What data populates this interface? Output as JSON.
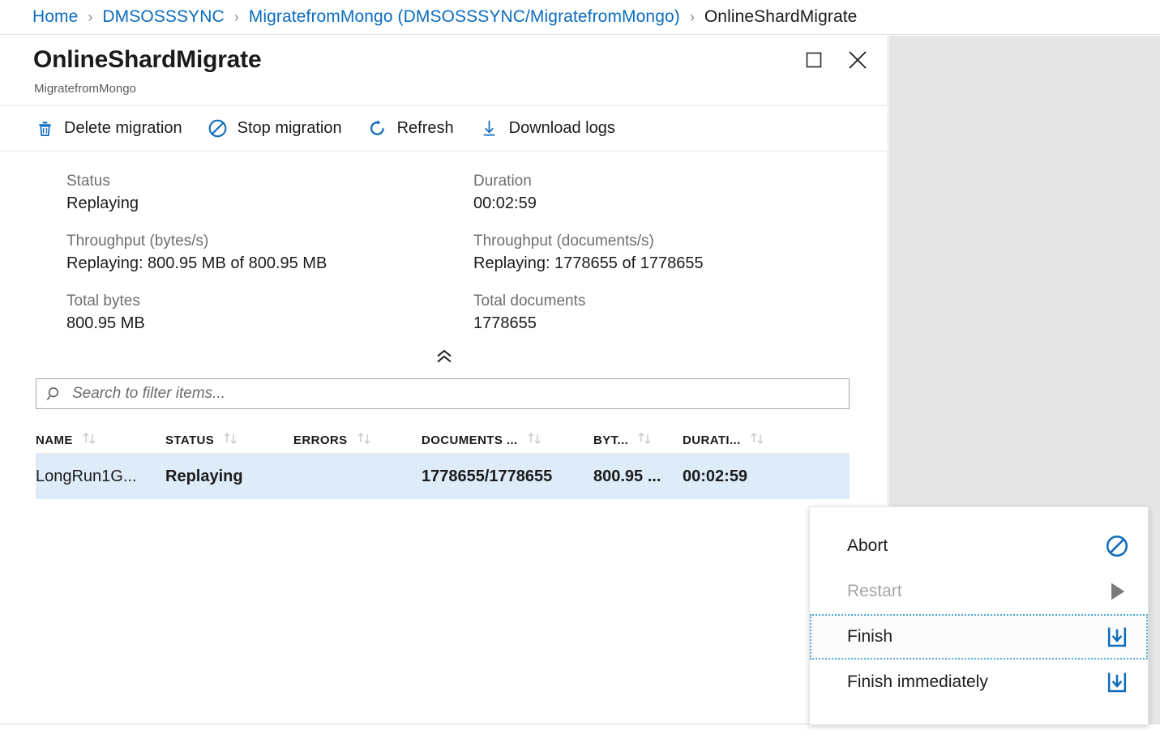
{
  "breadcrumb": {
    "separator": "›",
    "items": [
      {
        "label": "Home",
        "current": false
      },
      {
        "label": "DMSOSSSYNC",
        "current": false
      },
      {
        "label": "MigratefromMongo (DMSOSSSYNC/MigratefromMongo)",
        "current": false
      },
      {
        "label": "OnlineShardMigrate",
        "current": true
      }
    ]
  },
  "blade": {
    "title": "OnlineShardMigrate",
    "subtitle": "MigratefromMongo",
    "window_controls": [
      {
        "name": "maximize",
        "icon": "maximize-icon"
      },
      {
        "name": "close",
        "icon": "close-icon"
      }
    ]
  },
  "toolbar": {
    "commands": [
      {
        "label": "Delete migration",
        "icon": "trash-icon"
      },
      {
        "label": "Stop migration",
        "icon": "prohibition-icon"
      },
      {
        "label": "Refresh",
        "icon": "refresh-icon"
      },
      {
        "label": "Download logs",
        "icon": "download-icon"
      }
    ]
  },
  "metrics": [
    [
      {
        "label": "Status",
        "value": "Replaying"
      },
      {
        "label": "Duration",
        "value": "00:02:59"
      }
    ],
    [
      {
        "label": "Throughput (bytes/s)",
        "value": "Replaying: 800.95 MB of 800.95 MB"
      },
      {
        "label": "Throughput (documents/s)",
        "value": "Replaying: 1778655 of 1778655"
      }
    ],
    [
      {
        "label": "Total bytes",
        "value": "800.95 MB"
      },
      {
        "label": "Total documents",
        "value": "1778655"
      }
    ]
  ],
  "collapse": {
    "icon": "chevron-double-up-icon"
  },
  "search": {
    "placeholder": "Search to filter items...",
    "value": "",
    "icon": "search-icon"
  },
  "table": {
    "columns": [
      {
        "label": "NAME",
        "key": "name",
        "sortable": true
      },
      {
        "label": "STATUS",
        "key": "status",
        "sortable": true
      },
      {
        "label": "ERRORS",
        "key": "errors",
        "sortable": true
      },
      {
        "label": "DOCUMENTS ...",
        "key": "documents",
        "sortable": true
      },
      {
        "label": "BYT...",
        "key": "bytes",
        "sortable": true
      },
      {
        "label": "DURATI...",
        "key": "duration",
        "sortable": true
      }
    ],
    "rows": [
      {
        "name": "LongRun1G...",
        "status": "Replaying",
        "errors": "",
        "documents": "1778655/1778655",
        "bytes": "800.95 ...",
        "duration": "00:02:59",
        "selected": true
      }
    ]
  },
  "context_menu": {
    "items": [
      {
        "label": "Abort",
        "icon": "prohibition-icon",
        "disabled": false,
        "focused": false
      },
      {
        "label": "Restart",
        "icon": "play-icon",
        "disabled": true,
        "focused": false
      },
      {
        "label": "Finish",
        "icon": "download-tray-icon",
        "disabled": false,
        "focused": true
      },
      {
        "label": "Finish immediately",
        "icon": "download-tray-icon",
        "disabled": false,
        "focused": false
      }
    ]
  },
  "colors": {
    "link": "#0b6cbe",
    "accent": "#0f6cbd",
    "selected_row": "#deecf9",
    "focus_border": "#4fa8d4",
    "muted_text": "#6e6e6e",
    "backdrop": "#e6e6e6"
  }
}
